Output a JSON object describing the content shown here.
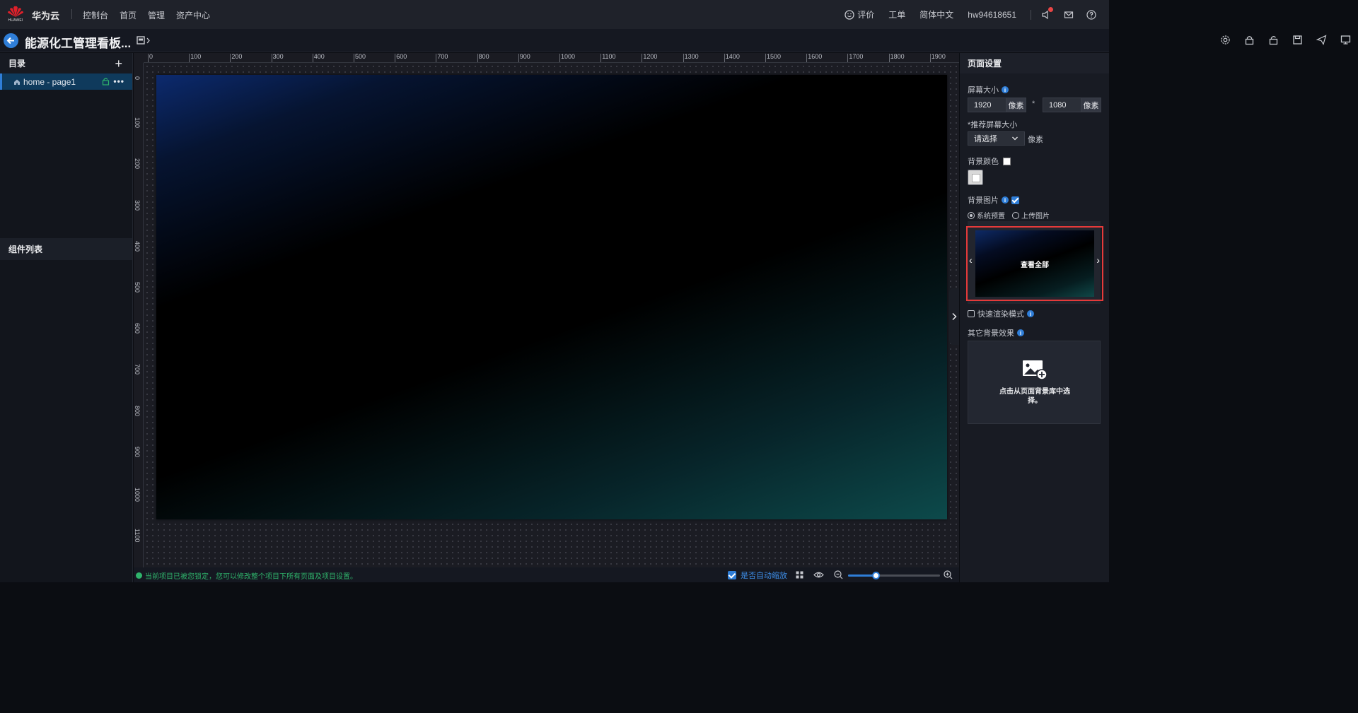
{
  "topnav": {
    "logo_text": "HUAWEI",
    "brand": "华为云",
    "links": [
      "控制台",
      "首页",
      "管理",
      "资产中心"
    ],
    "feedback": "评价",
    "ticket": "工单",
    "language": "简体中文",
    "username": "hw94618651"
  },
  "subhead": {
    "title": "能源化工管理看板..."
  },
  "left_panel": {
    "catalog_title": "目录",
    "page_item": "home - page1",
    "component_list_title": "组件列表"
  },
  "ruler": {
    "top_labels": [
      "0",
      "100",
      "200",
      "300",
      "400",
      "500",
      "600",
      "700",
      "800",
      "900",
      "1000",
      "1100",
      "1200",
      "1300",
      "1400",
      "1500",
      "1600",
      "1700",
      "1800",
      "1900"
    ],
    "left_labels": [
      "0",
      "100",
      "200",
      "300",
      "400",
      "500",
      "600",
      "700",
      "800",
      "900",
      "1000",
      "1100"
    ]
  },
  "statusbar": {
    "message": "当前项目已被您锁定，您可以修改整个项目下所有页面及项目设置。",
    "auto_zoom_label": "是否自动缩放",
    "auto_zoom_checked": true,
    "zoom_fraction": 0.3
  },
  "right_panel": {
    "title": "页面设置",
    "screen_size_label": "屏幕大小",
    "width": "1920",
    "height": "1080",
    "unit": "像素",
    "times": "*",
    "recommended_label": "*推荐屏幕大小",
    "select_placeholder": "请选择",
    "select_unit": "像素",
    "bg_color_label": "背景颜色",
    "bg_image_label": "背景图片",
    "radio_system": "系统预置",
    "radio_upload": "上传图片",
    "view_all": "查看全部",
    "fast_render_label": "快速渲染模式",
    "other_effects_label": "其它背景效果",
    "upload_text": "点击从页面背景库中选择。",
    "accent_color": "#2f7ed8",
    "highlight_color": "#e53a3a"
  }
}
